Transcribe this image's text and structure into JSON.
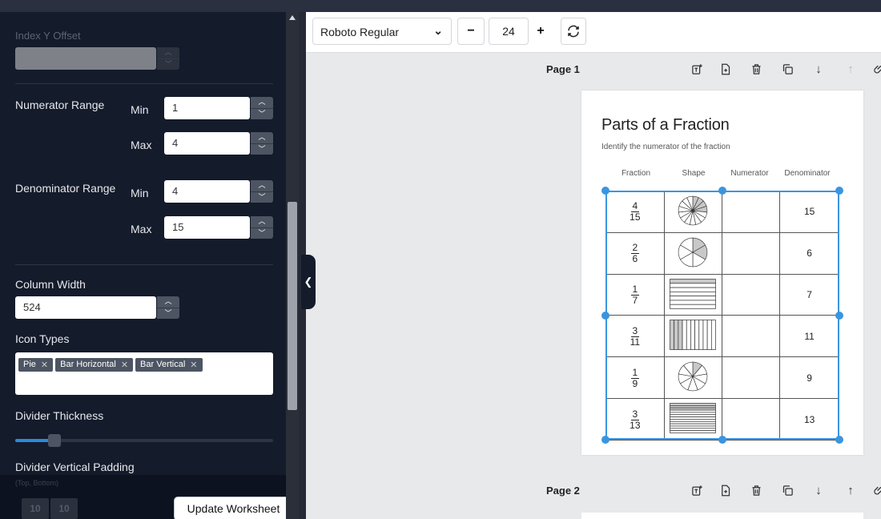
{
  "sidebar": {
    "index_y_offset": {
      "label": "Index Y Offset"
    },
    "numerator_range": {
      "label": "Numerator Range",
      "min_label": "Min",
      "max_label": "Max",
      "min_value": "1",
      "max_value": "4"
    },
    "denominator_range": {
      "label": "Denominator Range",
      "min_label": "Min",
      "max_label": "Max",
      "min_value": "4",
      "max_value": "15"
    },
    "column_width": {
      "label": "Column Width",
      "value": "524"
    },
    "icon_types": {
      "label": "Icon Types",
      "tags": [
        "Pie",
        "Bar Horizontal",
        "Bar Vertical"
      ],
      "remove_glyph": "✕"
    },
    "divider_thickness": {
      "label": "Divider Thickness",
      "value_fraction": 0.15
    },
    "divider_vertical_padding": {
      "label": "Divider Vertical Padding",
      "hint": "(Top, Bottom)",
      "top": "10",
      "bottom": "10"
    },
    "update_button": "Update Worksheet"
  },
  "toolbar": {
    "font": "Roboto Regular",
    "minus": "−",
    "size": "24",
    "plus": "+",
    "reset_icon": "refresh-icon"
  },
  "pages": [
    {
      "label": "Page 1"
    },
    {
      "label": "Page 2"
    }
  ],
  "page_tools": {
    "add_text": "add-text-icon",
    "add_page": "add-page-icon",
    "delete": "trash-icon",
    "duplicate": "copy-icon",
    "down": "↓",
    "up": "↑",
    "more": "clip-icon"
  },
  "worksheet": {
    "title": "Parts of a Fraction",
    "subtitle": "Identify the numerator of the fraction",
    "headers": [
      "Fraction",
      "Shape",
      "Numerator",
      "Denominator"
    ],
    "rows": [
      {
        "num": "4",
        "den": "15",
        "shape": "pie",
        "denominator": "15"
      },
      {
        "num": "2",
        "den": "6",
        "shape": "pie",
        "denominator": "6"
      },
      {
        "num": "1",
        "den": "7",
        "shape": "bar-horizontal",
        "denominator": "7"
      },
      {
        "num": "3",
        "den": "11",
        "shape": "bar-vertical",
        "denominator": "11"
      },
      {
        "num": "1",
        "den": "9",
        "shape": "pie",
        "denominator": "9"
      },
      {
        "num": "3",
        "den": "13",
        "shape": "bar-horizontal",
        "denominator": "13"
      }
    ]
  },
  "colors": {
    "selection": "#3a95e0",
    "sidebar_bg": "#141b2b",
    "shape_fill": "#c8c8c8"
  }
}
